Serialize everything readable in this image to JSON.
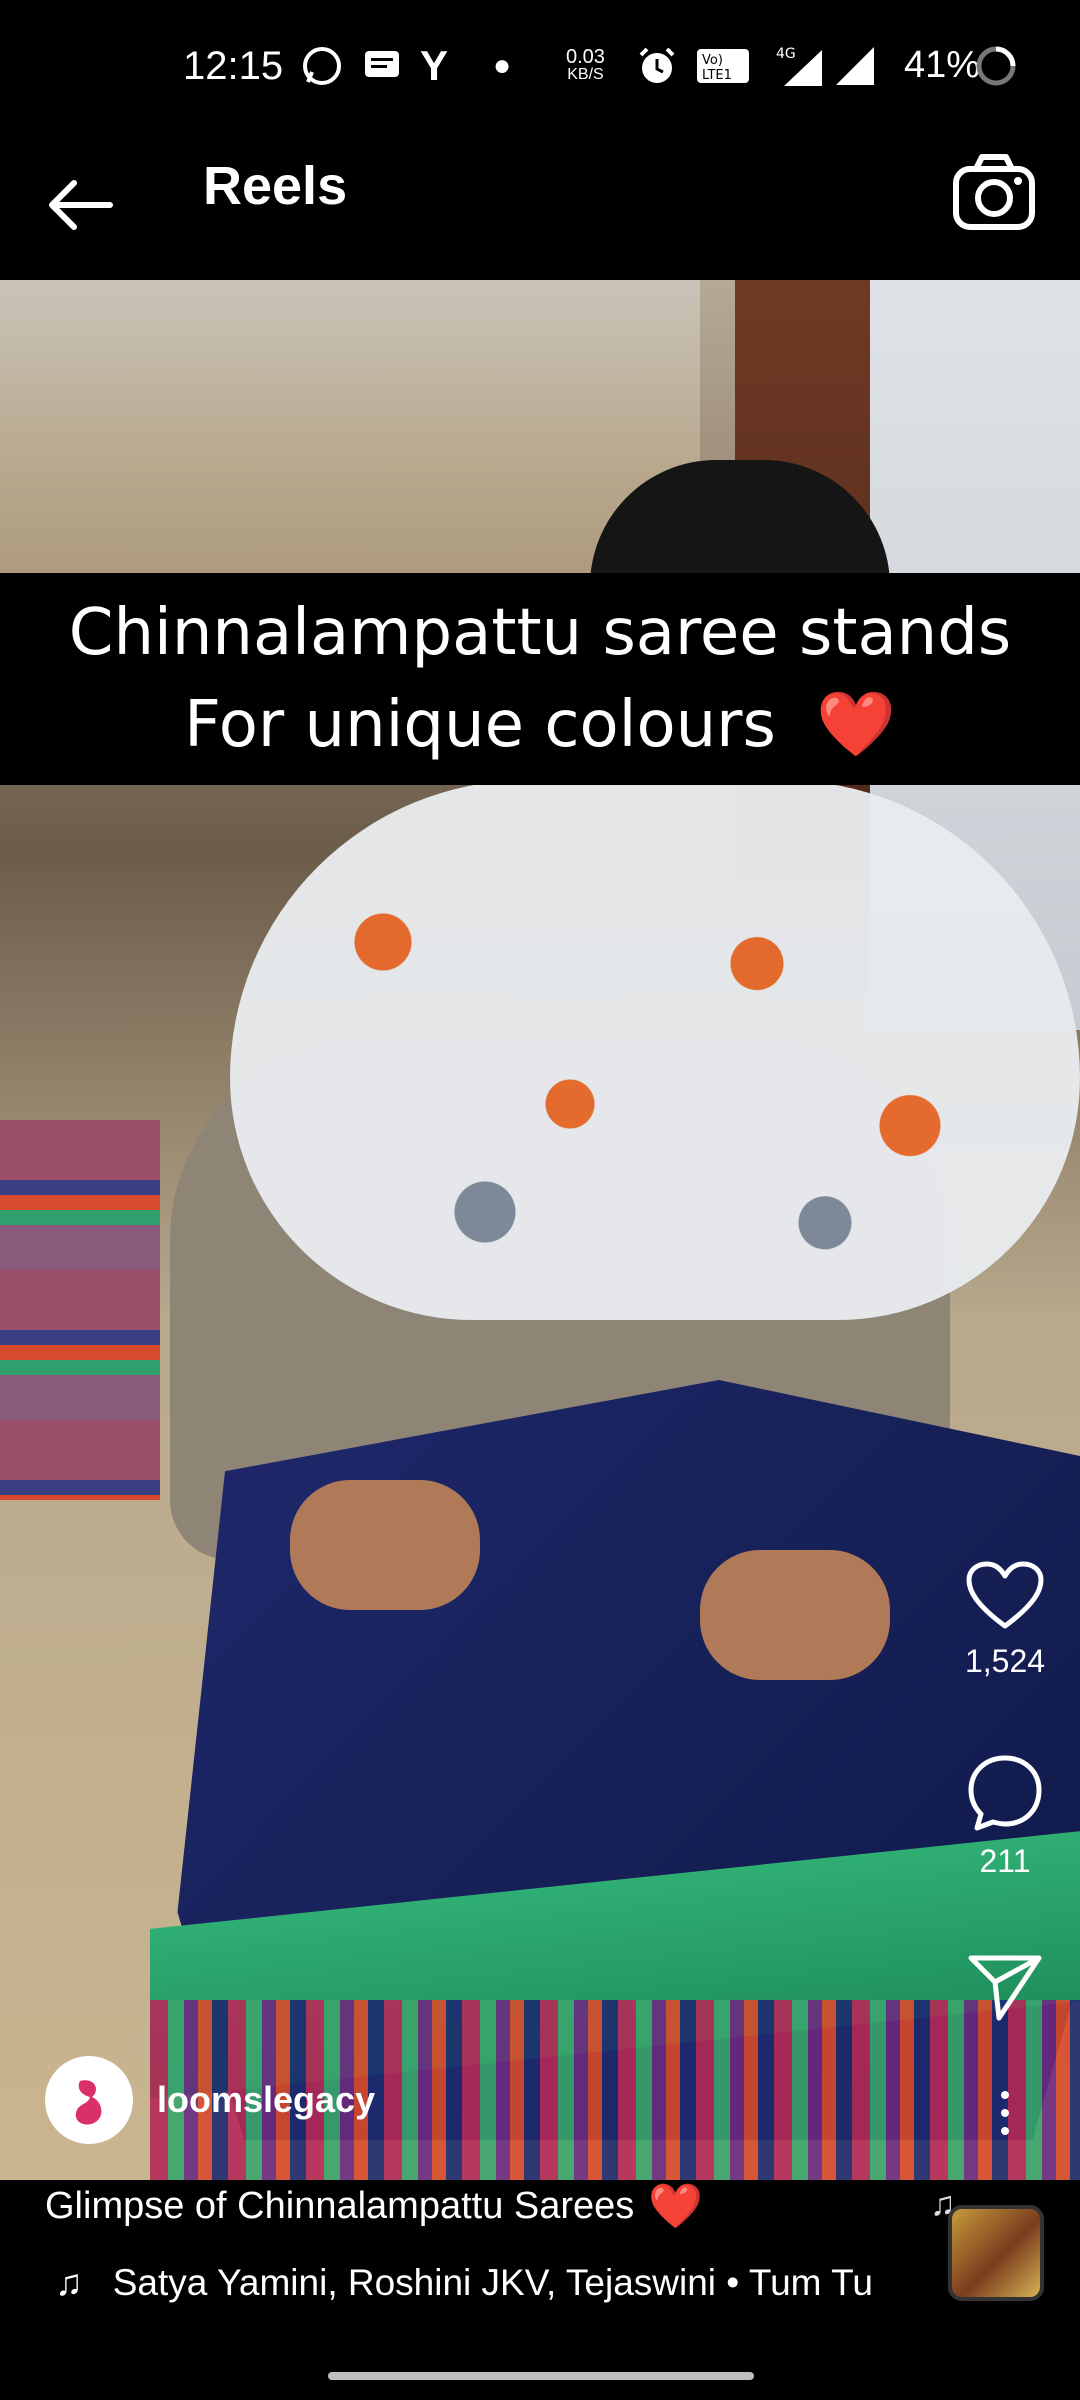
{
  "status_bar": {
    "time": "12:15",
    "network_speed_value": "0.03",
    "network_speed_unit": "KB/S",
    "battery": "41%",
    "icons": [
      "whatsapp-icon",
      "message-icon",
      "y-app-icon",
      "dot-icon",
      "alarm-icon",
      "volte-icon",
      "4g-signal-icon",
      "signal-icon",
      "battery-saver-icon"
    ]
  },
  "header": {
    "title": "Reels",
    "back_icon": "arrow-left-icon",
    "camera_icon": "camera-icon"
  },
  "reel": {
    "overlay_line1": "Chinnalampattu saree stands",
    "overlay_line2": "For unique colours",
    "overlay_emoji": "❤️",
    "like_count": "1,524",
    "comment_count": "211",
    "author": "loomslegacy",
    "caption": "Glimpse of  Chinnalampattu  Sarees",
    "caption_emoji": "❤️",
    "audio_note": "♫",
    "audio": "Satya Yamini, Roshini JKV, Tejaswini • Tum Tu"
  },
  "colors": {
    "background": "#000000",
    "text": "#ffffff",
    "heart": "#e0242c"
  }
}
